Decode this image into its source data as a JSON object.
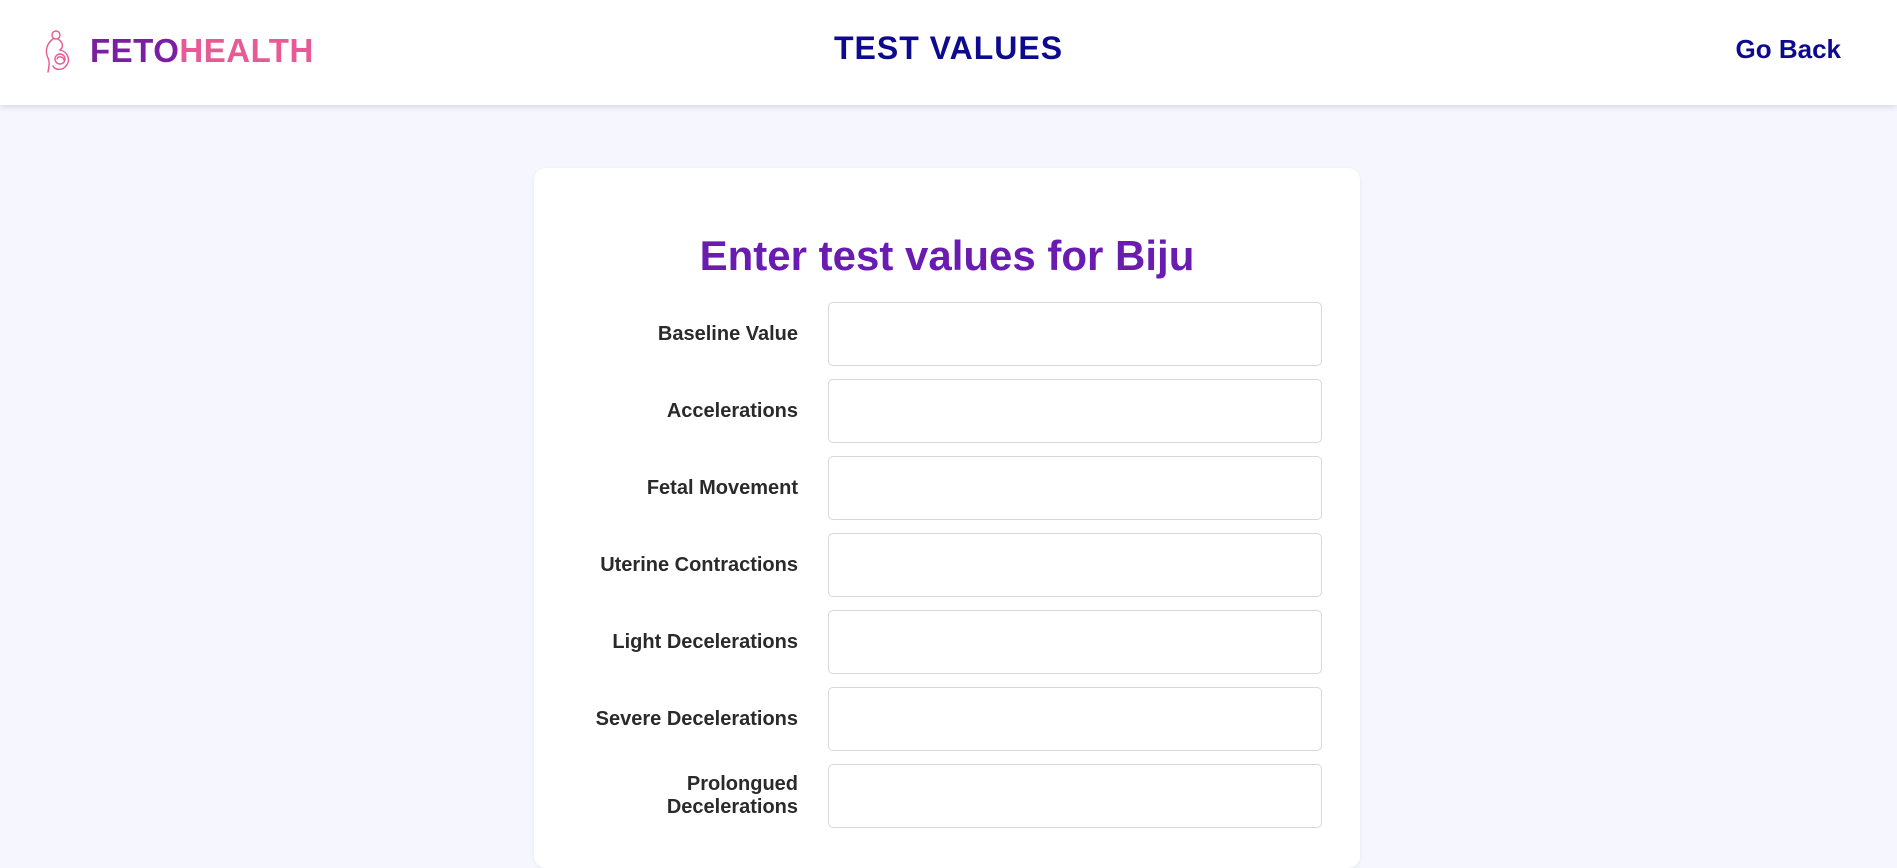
{
  "navbar": {
    "brand_part1": "FETO",
    "brand_part2": "HEALTH",
    "brand_icon": "pregnant-woman-icon",
    "title": "TEST VALUES",
    "go_back_label": "Go Back"
  },
  "colors": {
    "brand_purple": "#7b1fa2",
    "brand_pink": "#e85a95",
    "navy": "#0d0a8f",
    "heading_purple": "#6a1bb0",
    "background": "#f5f6fe"
  },
  "form": {
    "heading": "Enter test values for Biju",
    "fields": [
      {
        "label": "Baseline Value",
        "value": ""
      },
      {
        "label": "Accelerations",
        "value": ""
      },
      {
        "label": "Fetal Movement",
        "value": ""
      },
      {
        "label": "Uterine Contractions",
        "value": ""
      },
      {
        "label": "Light Decelerations",
        "value": ""
      },
      {
        "label": "Severe Decelerations",
        "value": ""
      },
      {
        "label": "Prolongued Decelerations",
        "value": ""
      }
    ]
  }
}
